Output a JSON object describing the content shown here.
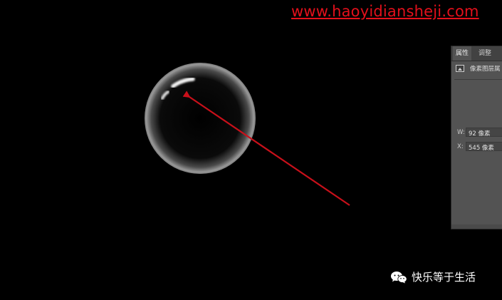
{
  "watermark_url": "www.haoyidiansheji.com",
  "panel": {
    "tabs": [
      {
        "label": "属性",
        "active": true
      },
      {
        "label": "调整",
        "active": false
      }
    ],
    "layer_type": "像素图层属",
    "fields": {
      "width_label": "W:",
      "width_value": "92 像素",
      "x_label": "X:",
      "x_value": "545 像素"
    }
  },
  "watermark_brand": "快乐等于生活",
  "icons": [
    "image-layer-icon",
    "wechat-icon"
  ],
  "colors": {
    "background": "#000000",
    "watermark_url": "#e3101b",
    "arrow": "#c8101a",
    "panel": "#535353",
    "bubble_rim": "#ffffff"
  }
}
